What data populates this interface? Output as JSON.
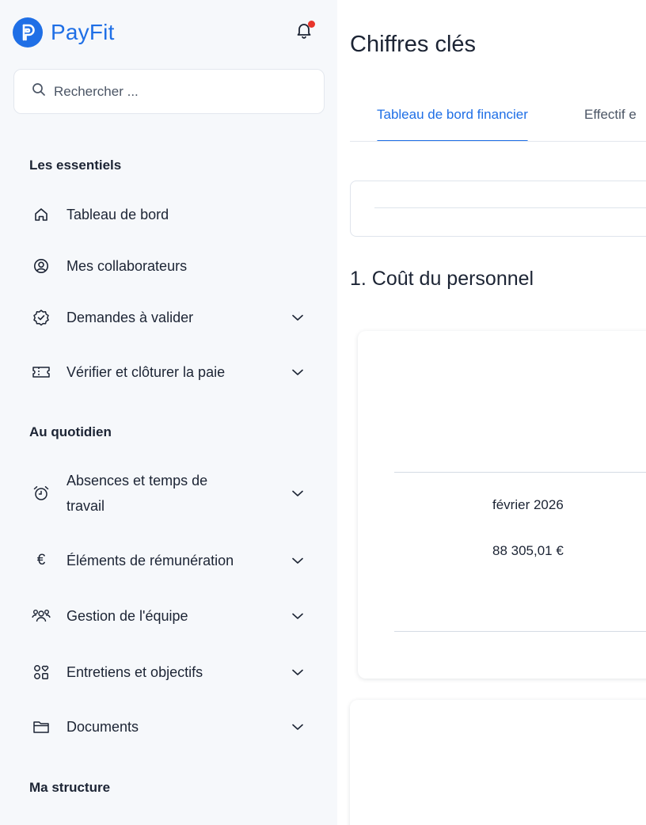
{
  "brand": {
    "name": "PayFit"
  },
  "search": {
    "placeholder": "Rechercher ..."
  },
  "sections": {
    "essentials": "Les essentiels",
    "daily": "Au quotidien",
    "structure": "Ma structure"
  },
  "nav": {
    "dashboard": {
      "label": "Tableau de bord",
      "icon": "home-icon"
    },
    "collaborators": {
      "label": "Mes collaborateurs",
      "icon": "user-circle-icon"
    },
    "requests": {
      "label": "Demandes à valider",
      "icon": "badge-check-icon"
    },
    "payroll": {
      "label": "Vérifier et clôturer la paie",
      "icon": "ticket-icon"
    },
    "absences_line1": "Absences et temps de",
    "absences_line2": "travail",
    "remuneration": {
      "label": "Éléments de rémunération",
      "icon": "euro-icon"
    },
    "team": {
      "label": "Gestion de l'équipe",
      "icon": "team-icon"
    },
    "reviews": {
      "label": "Entretiens et objectifs",
      "icon": "shapes-icon"
    },
    "documents": {
      "label": "Documents",
      "icon": "folder-icon"
    }
  },
  "main": {
    "title": "Chiffres clés",
    "tabs": [
      {
        "label": "Tableau de bord financier",
        "active": true
      },
      {
        "label": "Effectif e",
        "active": false
      }
    ],
    "section_heading": "1. Coût du personnel",
    "card": {
      "month": "février 2026",
      "amount": "88 305,01 €"
    }
  },
  "colors": {
    "accent": "#1f6fe6",
    "notification": "#e8352b",
    "sidebar_bg": "#f6f8fb"
  }
}
